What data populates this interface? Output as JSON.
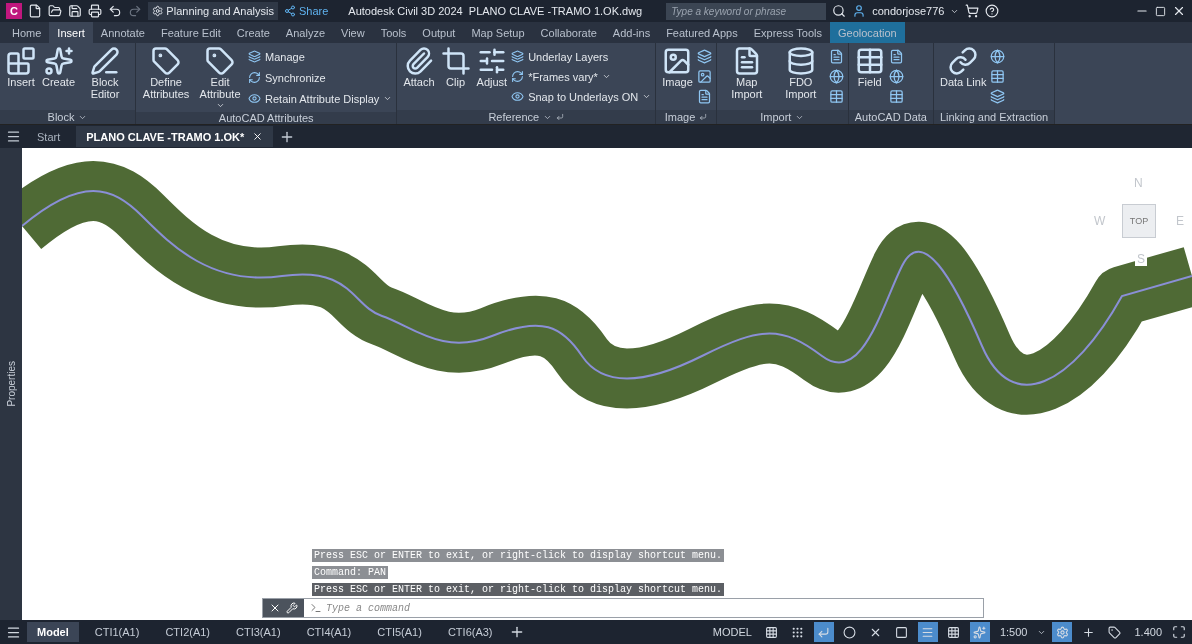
{
  "title_bar": {
    "app_letter": "C",
    "workspace": "Planning and Analysis",
    "share": "Share",
    "title": "Autodesk Civil 3D 2024  PLANO CLAVE -TRAMO 1.OK.dwg",
    "search": {
      "placeholder": "Type a keyword or phrase"
    },
    "user": "condorjose776"
  },
  "ribbon_tabs": [
    {
      "label": "Home",
      "selected": false,
      "contextual": false
    },
    {
      "label": "Insert",
      "selected": true,
      "contextual": false
    },
    {
      "label": "Annotate",
      "selected": false,
      "contextual": false
    },
    {
      "label": "Feature Edit",
      "selected": false,
      "contextual": false
    },
    {
      "label": "Create",
      "selected": false,
      "contextual": false
    },
    {
      "label": "Analyze",
      "selected": false,
      "contextual": false
    },
    {
      "label": "View",
      "selected": false,
      "contextual": false
    },
    {
      "label": "Tools",
      "selected": false,
      "contextual": false
    },
    {
      "label": "Output",
      "selected": false,
      "contextual": false
    },
    {
      "label": "Map Setup",
      "selected": false,
      "contextual": false
    },
    {
      "label": "Collaborate",
      "selected": false,
      "contextual": false
    },
    {
      "label": "Add-ins",
      "selected": false,
      "contextual": false
    },
    {
      "label": "Featured Apps",
      "selected": false,
      "contextual": false
    },
    {
      "label": "Express Tools",
      "selected": false,
      "contextual": false
    },
    {
      "label": "Geolocation",
      "selected": false,
      "contextual": true
    }
  ],
  "ribbon_panels": [
    {
      "title": "Block",
      "menu": true,
      "launcher": false,
      "buttons": [
        {
          "label": "Insert",
          "kind": "large",
          "dropdown": false
        },
        {
          "label": "Create",
          "kind": "large",
          "dropdown": false
        },
        {
          "label": "Block Editor",
          "kind": "large",
          "dropdown": false
        }
      ]
    },
    {
      "title": "AutoCAD Attributes",
      "menu": false,
      "launcher": false,
      "buttons": [
        {
          "label": "Define Attributes",
          "kind": "large",
          "dropdown": false
        },
        {
          "label": "Edit Attribute",
          "kind": "large",
          "dropdown": true
        },
        {
          "label": "Manage",
          "kind": "small",
          "dropdown": false
        },
        {
          "label": "Synchronize",
          "kind": "small",
          "dropdown": false
        },
        {
          "label": "Retain Attribute Display",
          "kind": "small",
          "dropdown": true
        }
      ]
    },
    {
      "title": "Reference",
      "menu": true,
      "launcher": true,
      "buttons": [
        {
          "label": "Attach",
          "kind": "large",
          "dropdown": false
        },
        {
          "label": "Clip",
          "kind": "large",
          "dropdown": false
        },
        {
          "label": "Adjust",
          "kind": "large",
          "dropdown": false
        },
        {
          "label": "Underlay Layers",
          "kind": "small",
          "dropdown": false
        },
        {
          "label": "*Frames vary*",
          "kind": "small",
          "dropdown": true
        },
        {
          "label": "Snap to Underlays ON",
          "kind": "small",
          "dropdown": true
        }
      ]
    },
    {
      "title": "Image",
      "menu": false,
      "launcher": true,
      "buttons": [
        {
          "label": "Image",
          "kind": "large",
          "dropdown": false
        },
        {
          "kind": "icon"
        },
        {
          "kind": "icon"
        },
        {
          "kind": "icon"
        }
      ]
    },
    {
      "title": "Import",
      "menu": true,
      "launcher": false,
      "buttons": [
        {
          "label": "Map Import",
          "kind": "large",
          "dropdown": false
        },
        {
          "label": "FDO Import",
          "kind": "large",
          "dropdown": false
        },
        {
          "kind": "icon"
        },
        {
          "kind": "icon"
        },
        {
          "kind": "icon"
        }
      ]
    },
    {
      "title": "AutoCAD Data",
      "menu": false,
      "launcher": false,
      "buttons": [
        {
          "label": "Field",
          "kind": "large",
          "dropdown": false
        },
        {
          "kind": "icon"
        },
        {
          "kind": "icon"
        },
        {
          "kind": "icon"
        }
      ]
    },
    {
      "title": "Linking and Extraction",
      "menu": false,
      "launcher": false,
      "buttons": [
        {
          "label": "Data Link",
          "kind": "large",
          "dropdown": false
        },
        {
          "kind": "icon"
        },
        {
          "kind": "icon"
        },
        {
          "kind": "icon"
        }
      ]
    }
  ],
  "doc_tabs": [
    {
      "label": "Start",
      "selected": false,
      "closable": false
    },
    {
      "label": "PLANO CLAVE -TRAMO 1.OK*",
      "selected": true,
      "closable": true
    }
  ],
  "palette": {
    "title": "Properties"
  },
  "viewcube": {
    "face": "TOP",
    "north": "N",
    "west": "W",
    "east": "E",
    "south": "S"
  },
  "command_history": [
    "Press ESC or ENTER to exit, or right-click to display shortcut menu.",
    "Command: PAN",
    "Press ESC or ENTER to exit, or right-click to display shortcut menu."
  ],
  "command_line": {
    "placeholder": "Type a command"
  },
  "layout_tabs": [
    {
      "label": "Model",
      "selected": true
    },
    {
      "label": "CTI1(A1)",
      "selected": false
    },
    {
      "label": "CTI2(A1)",
      "selected": false
    },
    {
      "label": "CTI3(A1)",
      "selected": false
    },
    {
      "label": "CTI4(A1)",
      "selected": false
    },
    {
      "label": "CTI5(A1)",
      "selected": false
    },
    {
      "label": "CTI6(A3)",
      "selected": false
    }
  ],
  "status_bar": {
    "space": "MODEL",
    "scale": "1:500",
    "lineweight": "1.400",
    "toggles": [
      {
        "on": false
      },
      {
        "on": false
      },
      {
        "on": true
      },
      {
        "on": false
      },
      {
        "on": false
      },
      {
        "on": false
      },
      {
        "on": true
      },
      {
        "on": false
      },
      {
        "on": true
      },
      {
        "on": true
      },
      {
        "on": false
      },
      {
        "on": false
      }
    ]
  }
}
